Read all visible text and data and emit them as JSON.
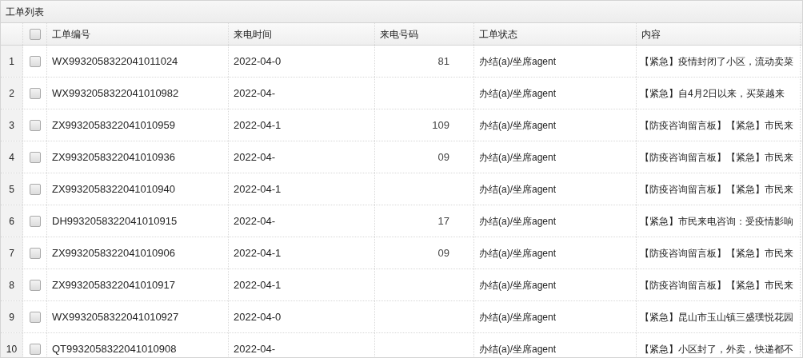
{
  "panel": {
    "title": "工单列表"
  },
  "table": {
    "header_checkbox": {
      "checked": false
    },
    "columns": [
      "工单编号",
      "来电时间",
      "来电号码",
      "工单状态",
      "内容"
    ],
    "rows": [
      {
        "index": "1",
        "checked": false,
        "id": "WX9932058322041011024",
        "time": "2022-04-0",
        "phone": "81",
        "status": "办结(a)/坐席agent",
        "content": "【紧急】疫情封闭了小区，流动卖菜"
      },
      {
        "index": "2",
        "checked": false,
        "id": "WX9932058322041010982",
        "time": "2022-04-",
        "status": "办结(a)/坐席agent",
        "content": "【紧急】自4月2日以来，买菜越来"
      },
      {
        "index": "3",
        "checked": false,
        "id": "ZX9932058322041010959",
        "time": "2022-04-1",
        "phone": "109",
        "status": "办结(a)/坐席agent",
        "content": "【防疫咨询留言板】【紧急】市民来"
      },
      {
        "index": "4",
        "checked": false,
        "id": "ZX9932058322041010936",
        "time": "2022-04-",
        "phone": "09",
        "status": "办结(a)/坐席agent",
        "content": "【防疫咨询留言板】【紧急】市民来"
      },
      {
        "index": "5",
        "checked": false,
        "id": "ZX9932058322041010940",
        "time": "2022-04-1",
        "status": "办结(a)/坐席agent",
        "content": "【防疫咨询留言板】【紧急】市民来"
      },
      {
        "index": "6",
        "checked": false,
        "id": "DH9932058322041010915",
        "time": "2022-04-",
        "phone": "17",
        "status": "办结(a)/坐席agent",
        "content": "【紧急】市民来电咨询：受疫情影响"
      },
      {
        "index": "7",
        "checked": false,
        "id": "ZX9932058322041010906",
        "time": "2022-04-1",
        "phone": "09",
        "status": "办结(a)/坐席agent",
        "content": "【防疫咨询留言板】【紧急】市民来"
      },
      {
        "index": "8",
        "checked": false,
        "id": "ZX9932058322041010917",
        "time": "2022-04-1",
        "status": "办结(a)/坐席agent",
        "content": "【防疫咨询留言板】【紧急】市民来"
      },
      {
        "index": "9",
        "checked": false,
        "id": "WX9932058322041010927",
        "time": "2022-04-0",
        "status": "办结(a)/坐席agent",
        "content": "【紧急】昆山市玉山镇三盛璞悦花园"
      },
      {
        "index": "10",
        "checked": false,
        "id": "QT9932058322041010908",
        "time": "2022-04-",
        "status": "办结(a)/坐席agent",
        "content": "【紧急】小区封了，外卖，快递都不"
      }
    ]
  }
}
